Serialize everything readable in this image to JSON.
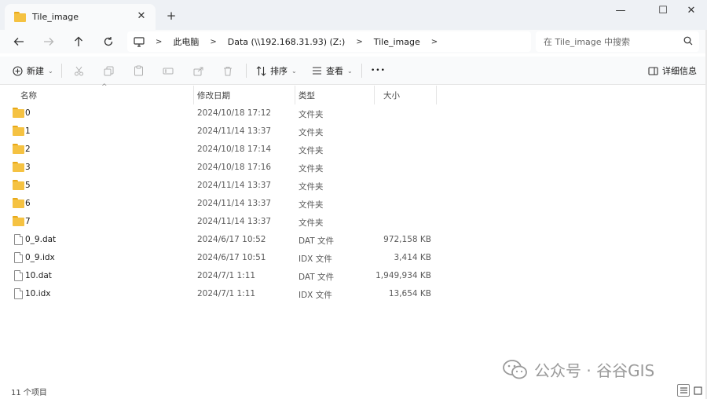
{
  "window": {
    "tab_title": "Tile_image",
    "new_tab_glyph": "+",
    "close_tab_glyph": "✕",
    "minimize_glyph": "—",
    "maximize_glyph": "☐",
    "close_glyph": "✕"
  },
  "breadcrumb": {
    "items": [
      "此电脑",
      "Data (\\\\192.168.31.93) (Z:)",
      "Tile_image"
    ],
    "separator": ">"
  },
  "search": {
    "placeholder": "在 Tile_image 中搜索"
  },
  "toolbar": {
    "new_label": "新建",
    "sort_label": "排序",
    "view_label": "查看",
    "more_glyph": "•••",
    "details_label": "详细信息"
  },
  "columns": {
    "name": "名称",
    "date": "修改日期",
    "type": "类型",
    "size": "大小"
  },
  "files": [
    {
      "name": "0",
      "date": "2024/10/18 17:12",
      "type": "文件夹",
      "size": "",
      "kind": "folder"
    },
    {
      "name": "1",
      "date": "2024/11/14 13:37",
      "type": "文件夹",
      "size": "",
      "kind": "folder"
    },
    {
      "name": "2",
      "date": "2024/10/18 17:14",
      "type": "文件夹",
      "size": "",
      "kind": "folder"
    },
    {
      "name": "3",
      "date": "2024/10/18 17:16",
      "type": "文件夹",
      "size": "",
      "kind": "folder"
    },
    {
      "name": "5",
      "date": "2024/11/14 13:37",
      "type": "文件夹",
      "size": "",
      "kind": "folder"
    },
    {
      "name": "6",
      "date": "2024/11/14 13:37",
      "type": "文件夹",
      "size": "",
      "kind": "folder"
    },
    {
      "name": "7",
      "date": "2024/11/14 13:37",
      "type": "文件夹",
      "size": "",
      "kind": "folder"
    },
    {
      "name": "0_9.dat",
      "date": "2024/6/17 10:52",
      "type": "DAT 文件",
      "size": "972,158 KB",
      "kind": "file"
    },
    {
      "name": "0_9.idx",
      "date": "2024/6/17 10:51",
      "type": "IDX 文件",
      "size": "3,414 KB",
      "kind": "file"
    },
    {
      "name": "10.dat",
      "date": "2024/7/1 1:11",
      "type": "DAT 文件",
      "size": "1,949,934 KB",
      "kind": "file"
    },
    {
      "name": "10.idx",
      "date": "2024/7/1 1:11",
      "type": "IDX 文件",
      "size": "13,654 KB",
      "kind": "file"
    }
  ],
  "status": {
    "item_count": "11 个项目"
  },
  "watermark": {
    "text": "公众号 · 谷谷GIS"
  },
  "colors": {
    "folder": "#f5c242",
    "titlebar": "#eef1f5",
    "toolbar": "#f9fafb"
  }
}
